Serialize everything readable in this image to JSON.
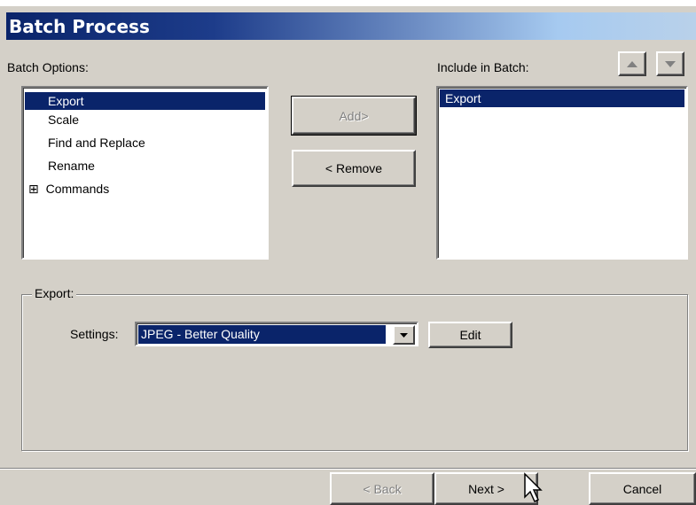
{
  "window": {
    "title": "Batch Process"
  },
  "batch_options": {
    "label": "Batch Options:",
    "items": [
      {
        "label": "Export",
        "selected": true
      },
      {
        "label": "Scale"
      },
      {
        "label": "Find and Replace"
      },
      {
        "label": "Rename"
      },
      {
        "label": "Commands",
        "expander": "⊞"
      }
    ]
  },
  "buttons": {
    "add": "Add>",
    "remove": "< Remove",
    "edit": "Edit",
    "back": "< Back",
    "next": "Next >",
    "cancel": "Cancel"
  },
  "include": {
    "label": "Include in Batch:",
    "items": [
      {
        "label": "Export",
        "selected": true
      }
    ]
  },
  "export_group": {
    "legend": "Export:",
    "settings_label": "Settings:",
    "settings_value": "JPEG - Better Quality"
  },
  "colors": {
    "selection": "#0a246a",
    "dialog_bg": "#d4d0c8",
    "title_start": "#0a246a",
    "title_end": "#a6caf0"
  }
}
